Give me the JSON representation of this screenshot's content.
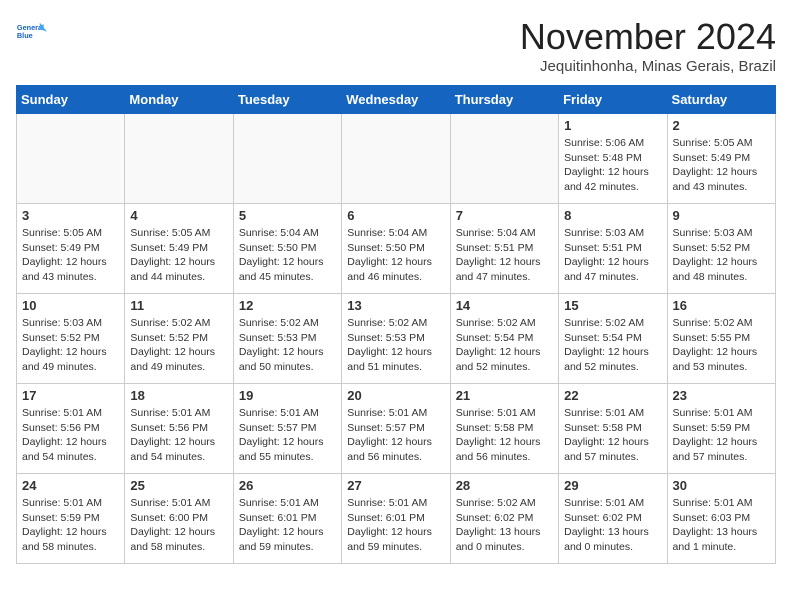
{
  "header": {
    "logo_line1": "General",
    "logo_line2": "Blue",
    "month_title": "November 2024",
    "location": "Jequitinhonha, Minas Gerais, Brazil"
  },
  "weekdays": [
    "Sunday",
    "Monday",
    "Tuesday",
    "Wednesday",
    "Thursday",
    "Friday",
    "Saturday"
  ],
  "weeks": [
    [
      {
        "day": "",
        "info": ""
      },
      {
        "day": "",
        "info": ""
      },
      {
        "day": "",
        "info": ""
      },
      {
        "day": "",
        "info": ""
      },
      {
        "day": "",
        "info": ""
      },
      {
        "day": "1",
        "info": "Sunrise: 5:06 AM\nSunset: 5:48 PM\nDaylight: 12 hours\nand 42 minutes."
      },
      {
        "day": "2",
        "info": "Sunrise: 5:05 AM\nSunset: 5:49 PM\nDaylight: 12 hours\nand 43 minutes."
      }
    ],
    [
      {
        "day": "3",
        "info": "Sunrise: 5:05 AM\nSunset: 5:49 PM\nDaylight: 12 hours\nand 43 minutes."
      },
      {
        "day": "4",
        "info": "Sunrise: 5:05 AM\nSunset: 5:49 PM\nDaylight: 12 hours\nand 44 minutes."
      },
      {
        "day": "5",
        "info": "Sunrise: 5:04 AM\nSunset: 5:50 PM\nDaylight: 12 hours\nand 45 minutes."
      },
      {
        "day": "6",
        "info": "Sunrise: 5:04 AM\nSunset: 5:50 PM\nDaylight: 12 hours\nand 46 minutes."
      },
      {
        "day": "7",
        "info": "Sunrise: 5:04 AM\nSunset: 5:51 PM\nDaylight: 12 hours\nand 47 minutes."
      },
      {
        "day": "8",
        "info": "Sunrise: 5:03 AM\nSunset: 5:51 PM\nDaylight: 12 hours\nand 47 minutes."
      },
      {
        "day": "9",
        "info": "Sunrise: 5:03 AM\nSunset: 5:52 PM\nDaylight: 12 hours\nand 48 minutes."
      }
    ],
    [
      {
        "day": "10",
        "info": "Sunrise: 5:03 AM\nSunset: 5:52 PM\nDaylight: 12 hours\nand 49 minutes."
      },
      {
        "day": "11",
        "info": "Sunrise: 5:02 AM\nSunset: 5:52 PM\nDaylight: 12 hours\nand 49 minutes."
      },
      {
        "day": "12",
        "info": "Sunrise: 5:02 AM\nSunset: 5:53 PM\nDaylight: 12 hours\nand 50 minutes."
      },
      {
        "day": "13",
        "info": "Sunrise: 5:02 AM\nSunset: 5:53 PM\nDaylight: 12 hours\nand 51 minutes."
      },
      {
        "day": "14",
        "info": "Sunrise: 5:02 AM\nSunset: 5:54 PM\nDaylight: 12 hours\nand 52 minutes."
      },
      {
        "day": "15",
        "info": "Sunrise: 5:02 AM\nSunset: 5:54 PM\nDaylight: 12 hours\nand 52 minutes."
      },
      {
        "day": "16",
        "info": "Sunrise: 5:02 AM\nSunset: 5:55 PM\nDaylight: 12 hours\nand 53 minutes."
      }
    ],
    [
      {
        "day": "17",
        "info": "Sunrise: 5:01 AM\nSunset: 5:56 PM\nDaylight: 12 hours\nand 54 minutes."
      },
      {
        "day": "18",
        "info": "Sunrise: 5:01 AM\nSunset: 5:56 PM\nDaylight: 12 hours\nand 54 minutes."
      },
      {
        "day": "19",
        "info": "Sunrise: 5:01 AM\nSunset: 5:57 PM\nDaylight: 12 hours\nand 55 minutes."
      },
      {
        "day": "20",
        "info": "Sunrise: 5:01 AM\nSunset: 5:57 PM\nDaylight: 12 hours\nand 56 minutes."
      },
      {
        "day": "21",
        "info": "Sunrise: 5:01 AM\nSunset: 5:58 PM\nDaylight: 12 hours\nand 56 minutes."
      },
      {
        "day": "22",
        "info": "Sunrise: 5:01 AM\nSunset: 5:58 PM\nDaylight: 12 hours\nand 57 minutes."
      },
      {
        "day": "23",
        "info": "Sunrise: 5:01 AM\nSunset: 5:59 PM\nDaylight: 12 hours\nand 57 minutes."
      }
    ],
    [
      {
        "day": "24",
        "info": "Sunrise: 5:01 AM\nSunset: 5:59 PM\nDaylight: 12 hours\nand 58 minutes."
      },
      {
        "day": "25",
        "info": "Sunrise: 5:01 AM\nSunset: 6:00 PM\nDaylight: 12 hours\nand 58 minutes."
      },
      {
        "day": "26",
        "info": "Sunrise: 5:01 AM\nSunset: 6:01 PM\nDaylight: 12 hours\nand 59 minutes."
      },
      {
        "day": "27",
        "info": "Sunrise: 5:01 AM\nSunset: 6:01 PM\nDaylight: 12 hours\nand 59 minutes."
      },
      {
        "day": "28",
        "info": "Sunrise: 5:02 AM\nSunset: 6:02 PM\nDaylight: 13 hours\nand 0 minutes."
      },
      {
        "day": "29",
        "info": "Sunrise: 5:01 AM\nSunset: 6:02 PM\nDaylight: 13 hours\nand 0 minutes."
      },
      {
        "day": "30",
        "info": "Sunrise: 5:01 AM\nSunset: 6:03 PM\nDaylight: 13 hours\nand 1 minute."
      }
    ]
  ]
}
